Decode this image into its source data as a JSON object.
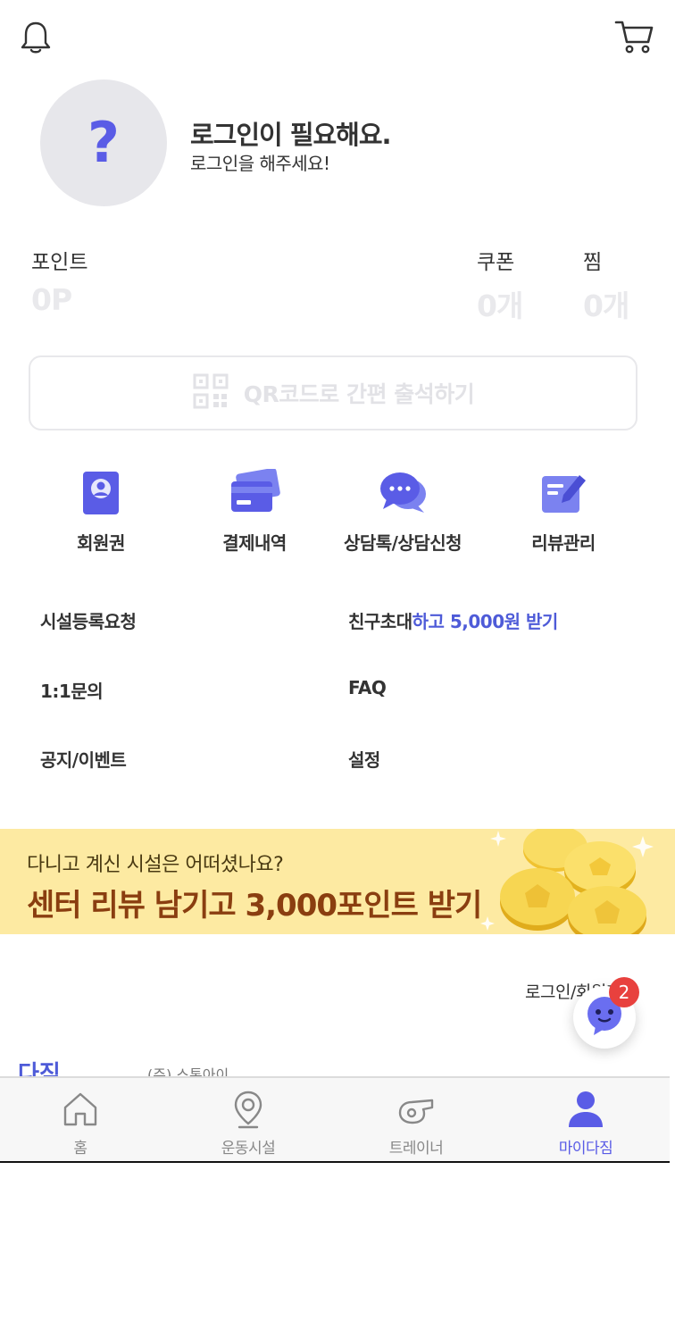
{
  "header": {
    "bell_icon": "bell-icon",
    "cart_icon": "cart-icon"
  },
  "profile": {
    "avatar_glyph": "?",
    "title": "로그인이 필요해요.",
    "subtitle": "로그인을 해주세요!"
  },
  "stats": {
    "points": {
      "label": "포인트",
      "value": "0P"
    },
    "coupons": {
      "label": "쿠폰",
      "value": "0개"
    },
    "likes": {
      "label": "찜",
      "value": "0개"
    }
  },
  "qr_button": {
    "label": "QR코드로 간편 출석하기",
    "icon": "qr-code-icon"
  },
  "quick_menu": [
    {
      "label": "회원권",
      "icon": "membership-card-icon"
    },
    {
      "label": "결제내역",
      "icon": "credit-card-icon"
    },
    {
      "label": "상담톡/상담신청",
      "icon": "chat-bubble-icon"
    },
    {
      "label": "리뷰관리",
      "icon": "edit-note-icon"
    }
  ],
  "menu": {
    "facility_request": "시설등록요청",
    "invite_prefix": "친구초대",
    "invite_highlight": "하고 5,000원 받기",
    "inquiry": "1:1문의",
    "faq": "FAQ",
    "notice": "공지/이벤트",
    "settings": "설정"
  },
  "banner": {
    "subtitle": "다니고 계신 시설은 어떠셨나요?",
    "title": "센터 리뷰 남기고 3,000포인트 받기"
  },
  "footer": {
    "login_link": "로그인/회원가입",
    "company_logo": "다짐",
    "company_name": "(주) 스톤아이"
  },
  "chat": {
    "badge_count": "2",
    "icon": "chatbot-icon"
  },
  "bottom_nav": [
    {
      "label": "홈",
      "icon": "home-icon",
      "active": false
    },
    {
      "label": "운동시설",
      "icon": "location-pin-icon",
      "active": false
    },
    {
      "label": "트레이너",
      "icon": "whistle-icon",
      "active": false
    },
    {
      "label": "마이다짐",
      "icon": "user-icon",
      "active": true
    }
  ],
  "colors": {
    "accent": "#5a5ce6",
    "highlight": "#4e5bd8",
    "banner_bg": "#fdeaa2",
    "banner_title": "#8a3e10",
    "badge": "#e8413e"
  }
}
